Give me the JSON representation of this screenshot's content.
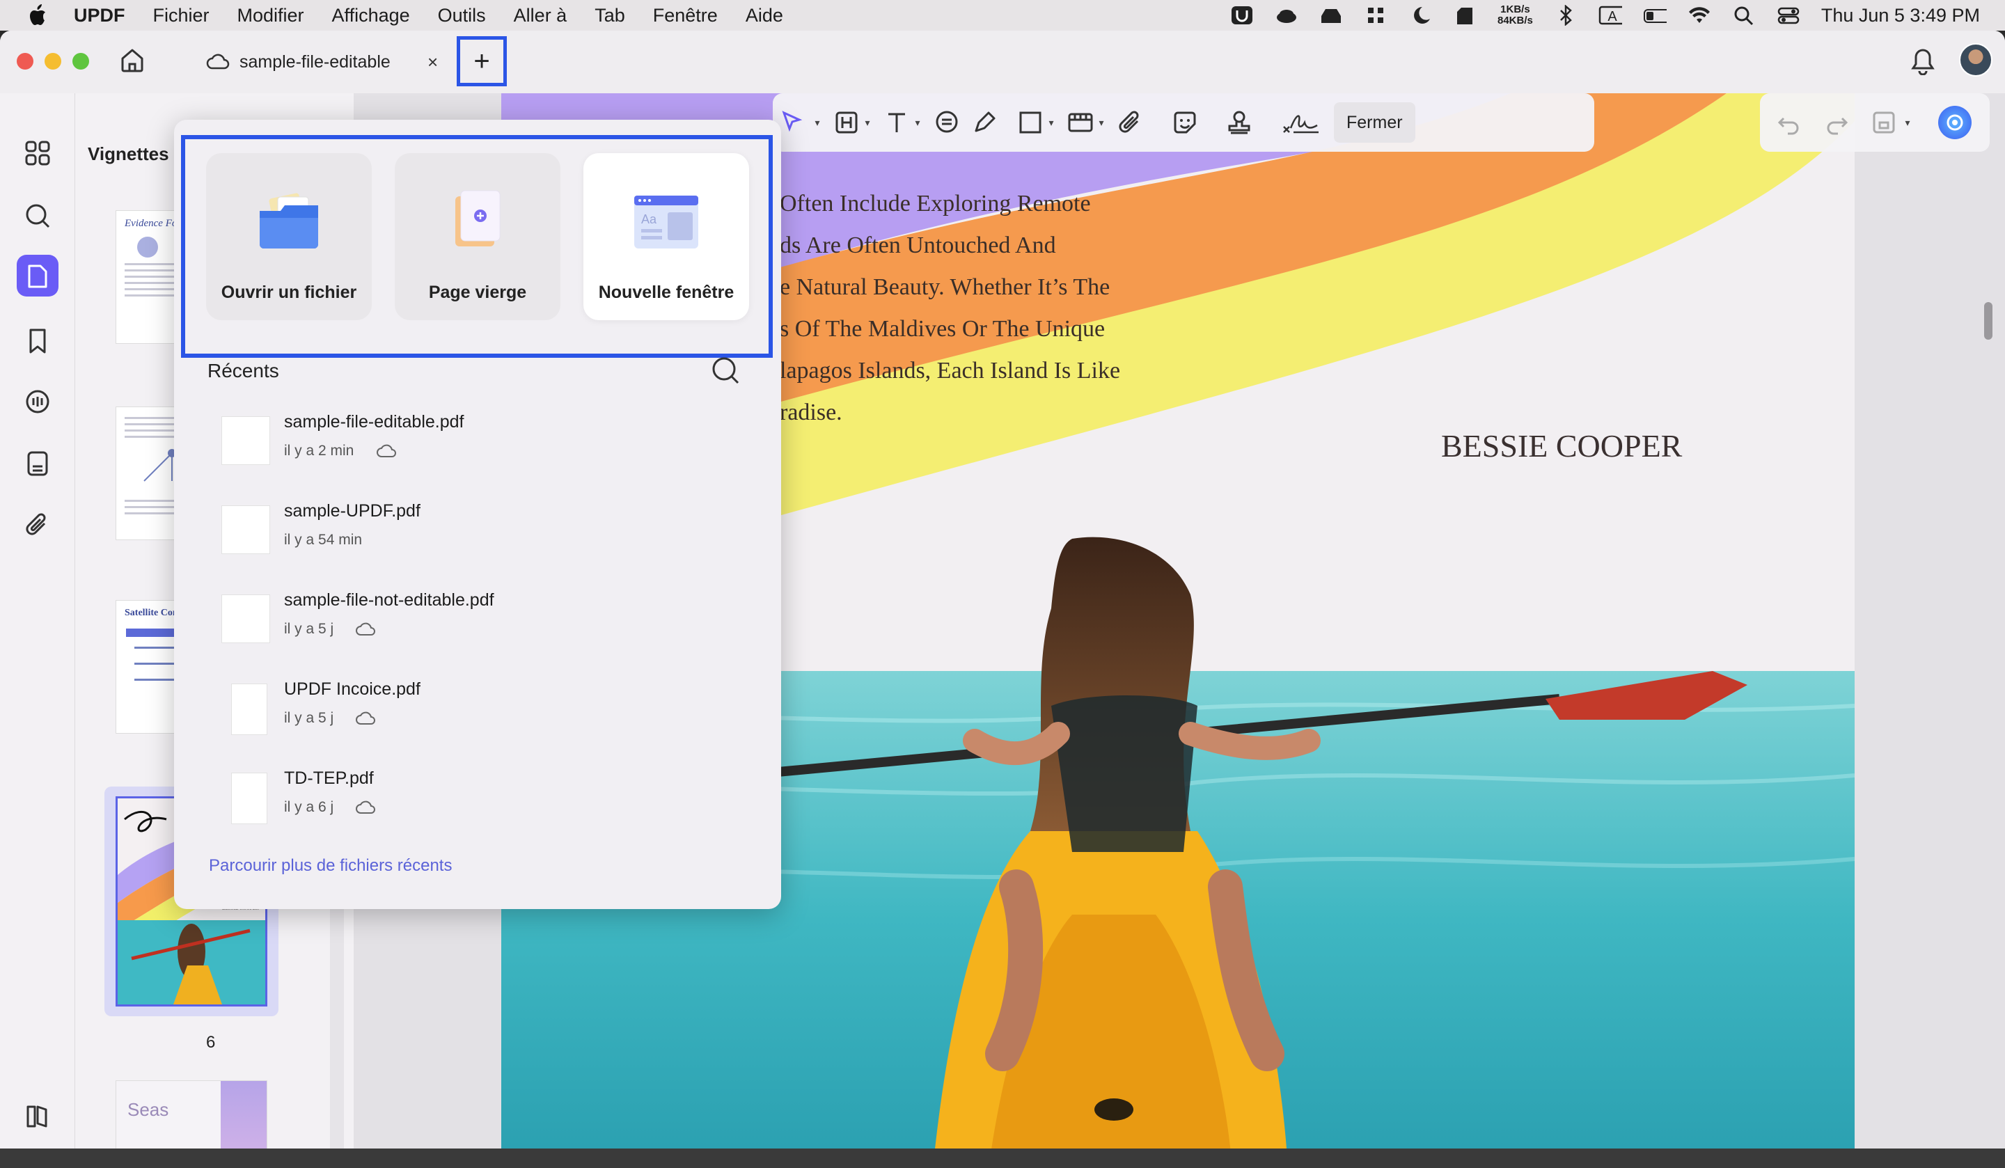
{
  "menubar": {
    "app": "UPDF",
    "items": [
      "Fichier",
      "Modifier",
      "Affichage",
      "Outils",
      "Aller à",
      "Tab",
      "Fenêtre",
      "Aide"
    ],
    "net_up": "1KB/s",
    "net_down": "84KB/s",
    "input_source": "A",
    "clock": "Thu Jun 5  3:49 PM"
  },
  "tab": {
    "title": "sample-file-editable",
    "close": "×",
    "new_tab": "+"
  },
  "sidebar": {
    "heading": "Vignettes",
    "page_number": "6",
    "icons": [
      "grid-icon",
      "search-icon",
      "pages-icon",
      "bookmark-icon",
      "comment-icon",
      "form-icon",
      "attachment-icon",
      "sidebar-toggle-icon"
    ]
  },
  "toolbar": {
    "close_label": "Fermer"
  },
  "popover": {
    "actions": [
      {
        "label": "Ouvrir un fichier",
        "icon": "folder-icon"
      },
      {
        "label": "Page vierge",
        "icon": "blank-page-icon"
      },
      {
        "label": "Nouvelle fenêtre",
        "icon": "new-window-icon"
      }
    ],
    "recents_title": "Récents",
    "recents": [
      {
        "name": "sample-file-editable.pdf",
        "time": "il y a 2 min",
        "cloud": true
      },
      {
        "name": "sample-UPDF.pdf",
        "time": "il y a 54 min",
        "cloud": false
      },
      {
        "name": "sample-file-not-editable.pdf",
        "time": "il y a 5 j",
        "cloud": true
      },
      {
        "name": "UPDF Incoice.pdf",
        "time": "il y a 5 j",
        "cloud": true
      },
      {
        "name": "TD-TEP.pdf",
        "time": "il y a 6 j",
        "cloud": true
      }
    ],
    "browse_more": "Parcourir plus de fichiers récents"
  },
  "document": {
    "lines": [
      "Often Include Exploring Remote",
      "ds Are Often Untouched And",
      "e Natural Beauty. Whether It’s The",
      "s Of The Maldives Or The Unique",
      "lapagos Islands, Each Island Is Like",
      "radise."
    ],
    "name": "BESSIE COOPER"
  },
  "thumbnails": {
    "page1_title": "Evidence For The",
    "page3_title": "Satellite Comm",
    "page6_name": "BESSIE COOPER",
    "page7_title": "Seas"
  }
}
